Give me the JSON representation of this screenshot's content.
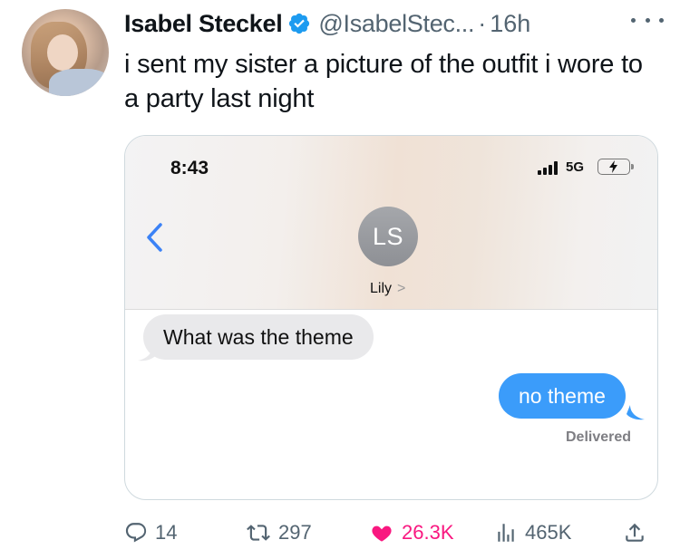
{
  "author": {
    "name": "Isabel Steckel",
    "handle": "@IsabelStec...",
    "separator": "·",
    "time": "16h",
    "avatar_icon": "profile-photo",
    "verified_icon": "verified-badge-icon"
  },
  "tweet": {
    "text": "i sent my sister a picture of the outfit i wore to a party last night"
  },
  "screenshot": {
    "status_time": "8:43",
    "network": "5G",
    "contact_initials": "LS",
    "contact_name": "Lily",
    "contact_chevron": ">",
    "incoming_message": "What was the theme",
    "outgoing_message": "no theme",
    "delivery_status": "Delivered",
    "colors": {
      "outgoing_bubble": "#3b9cfa",
      "incoming_bubble": "#e9e9eb",
      "back_arrow": "#3b82f6"
    }
  },
  "actions": {
    "replies": "14",
    "retweets": "297",
    "likes": "26.3K",
    "views": "465K",
    "like_color": "#f91880"
  }
}
